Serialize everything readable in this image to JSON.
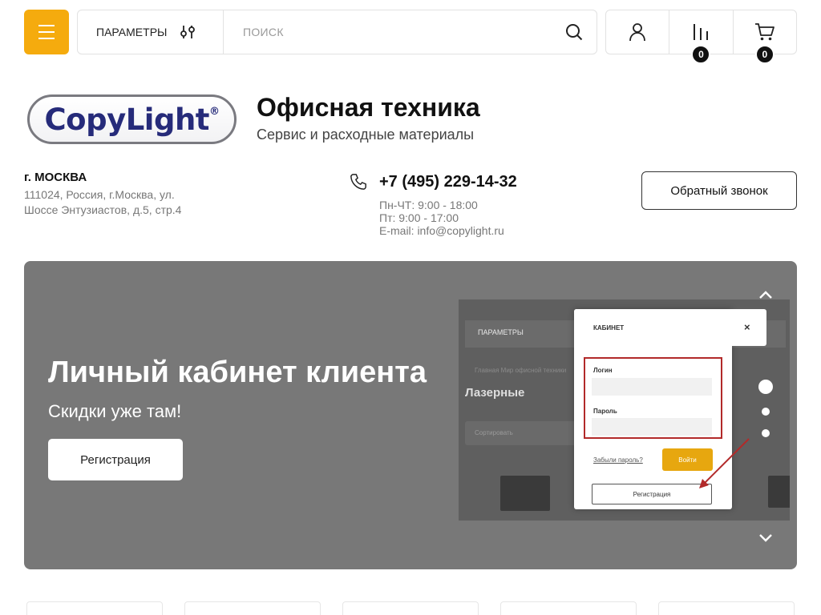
{
  "header": {
    "params_label": "ПАРАМЕТРЫ",
    "search_placeholder": "ПОИСК",
    "compare_count": "0",
    "cart_count": "0"
  },
  "brand": {
    "logo_text": "CopyLight",
    "logo_mark": "®",
    "title": "Офисная техника",
    "subtitle": "Сервис и расходные материалы"
  },
  "contacts": {
    "city": "г. МОСКВА",
    "address_line1": "111024, Россия, г.Москва, ул.",
    "address_line2": "Шоссе Энтузиастов, д.5, стр.4",
    "phone": "+7 (495) 229-14-32",
    "hours_line1": "Пн-ЧТ: 9:00 - 18:00",
    "hours_line2": "Пт: 9:00 - 17:00",
    "email_line": "E-mail: info@copylight.ru",
    "callback_label": "Обратный звонок"
  },
  "slider": {
    "title": "Личный кабинет клиента",
    "subtitle": "Скидки уже там!",
    "button_label": "Регистрация",
    "dots_count": 3,
    "active_dot": 1,
    "image": {
      "bg_params": "ПАРАМЕТРЫ",
      "bg_crumbs": "Главная      Мир офисной техники",
      "bg_heading": "Лазерные",
      "bg_sort": "Сортировать",
      "modal_title": "КАБИНЕТ",
      "close": "×",
      "login_label": "Логин",
      "password_label": "Пароль",
      "forgot": "Забыли пароль?",
      "enter": "Войти",
      "register": "Регистрация"
    }
  },
  "colors": {
    "accent": "#f5ab0e",
    "slider_bg": "#787878",
    "highlight_red": "#b22a2a"
  },
  "icons": [
    "menu-icon",
    "filter-icon",
    "search-icon",
    "user-icon",
    "compare-icon",
    "cart-icon",
    "phone-icon",
    "chevron-up-icon",
    "chevron-down-icon"
  ]
}
